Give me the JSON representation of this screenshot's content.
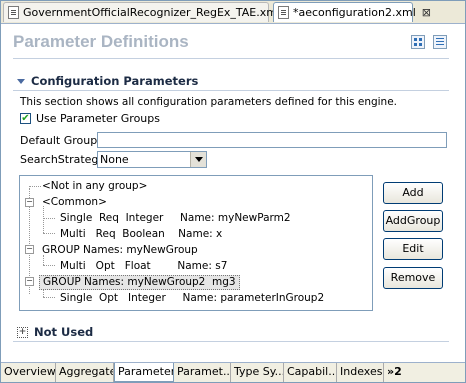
{
  "tabs": [
    {
      "label": "GovernmentOfficialRecognizer_RegEx_TAE.xml",
      "close": "⊠"
    },
    {
      "label": "*aeconfiguration2.xml",
      "close": "⊠"
    }
  ],
  "page_title": "Parameter Definitions",
  "section": {
    "title": "Configuration Parameters",
    "description": "This section shows all configuration parameters defined for this engine."
  },
  "use_groups": {
    "label": "Use Parameter Groups",
    "checked": true
  },
  "default_group": {
    "label": "Default Group",
    "value": ""
  },
  "search_strategy": {
    "label": "SearchStrategy",
    "value": "None"
  },
  "tree": [
    "<Not in any group>",
    "<Common>",
    "Single  Req  Integer     Name: myNewParm2",
    "Multi   Req  Boolean    Name: x",
    "GROUP Names: myNewGroup",
    "Multi   Opt   Float        Name: s7",
    "GROUP Names: myNewGroup2  mg3",
    "Single  Opt   Integer     Name: parameterInGroup2"
  ],
  "buttons": {
    "add": "Add",
    "add_group": "AddGroup",
    "edit": "Edit",
    "remove": "Remove"
  },
  "not_used": "Not Used",
  "page_tabs": [
    "Overview",
    "Aggregate",
    "Parameters",
    "Paramet...",
    "Type Sy...",
    "Capabil...",
    "Indexes",
    "»2"
  ]
}
